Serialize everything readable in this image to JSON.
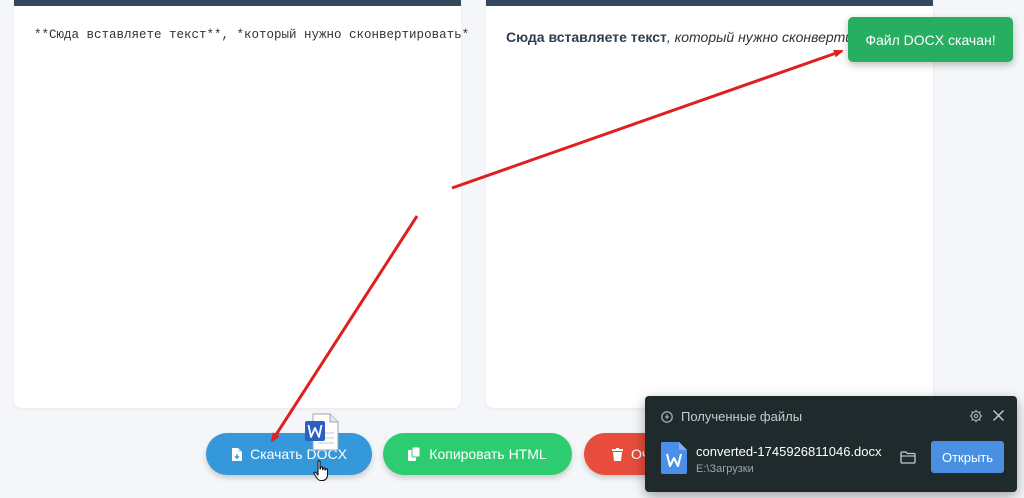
{
  "editor": {
    "markdown_input": "**Сюда вставляете текст**, *который нужно сконвертировать*",
    "preview_bold": "Сюда вставляете текст",
    "preview_italic": ", который нужно сконвертировать"
  },
  "toast": {
    "message": "Файл DOCX скачан!"
  },
  "buttons": {
    "download_docx": "Скачать DOCX",
    "copy_html": "Копировать HTML",
    "clear_partial": "Оч"
  },
  "downloads": {
    "title": "Полученные файлы",
    "file_name": "converted-1745926811046.docx",
    "file_path": "E:\\Загрузки",
    "open_label": "Открыть"
  },
  "colors": {
    "header_bar": "#34495e",
    "docx_button": "#3498db",
    "html_button": "#2ecc71",
    "clear_button": "#e74c3c",
    "toast": "#27ae60",
    "open_button": "#4a90e2",
    "arrow": "#e0201f"
  },
  "icons": {
    "docx_button": "file-download-icon",
    "html_button": "copy-icon",
    "clear_button": "trash-icon",
    "drag": "word-document-icon",
    "cursor": "hand-pointer-icon"
  }
}
